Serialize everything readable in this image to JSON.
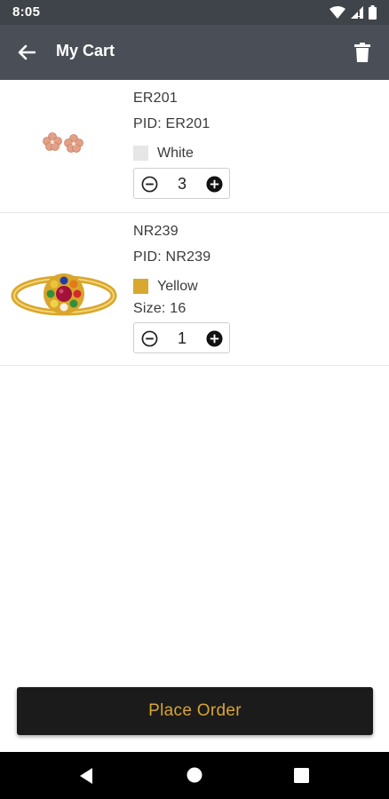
{
  "status_bar": {
    "time": "8:05"
  },
  "app_bar": {
    "title": "My Cart"
  },
  "cart_items": [
    {
      "name": "ER201",
      "pid": "PID: ER201",
      "color_label": "White",
      "color_swatch": "#e6e6e6",
      "quantity": "3",
      "image_icon": "earring-icon"
    },
    {
      "name": "NR239",
      "pid": "PID: NR239",
      "color_label": "Yellow",
      "color_swatch": "#d8a82f",
      "size": "Size: 16",
      "quantity": "1",
      "image_icon": "ring-icon"
    }
  ],
  "place_order": {
    "label": "Place Order"
  },
  "colors": {
    "status_bar": "#3f444b",
    "app_bar": "#4a4f57",
    "button_bg": "#1b1b1b",
    "button_text": "#d8a530"
  }
}
